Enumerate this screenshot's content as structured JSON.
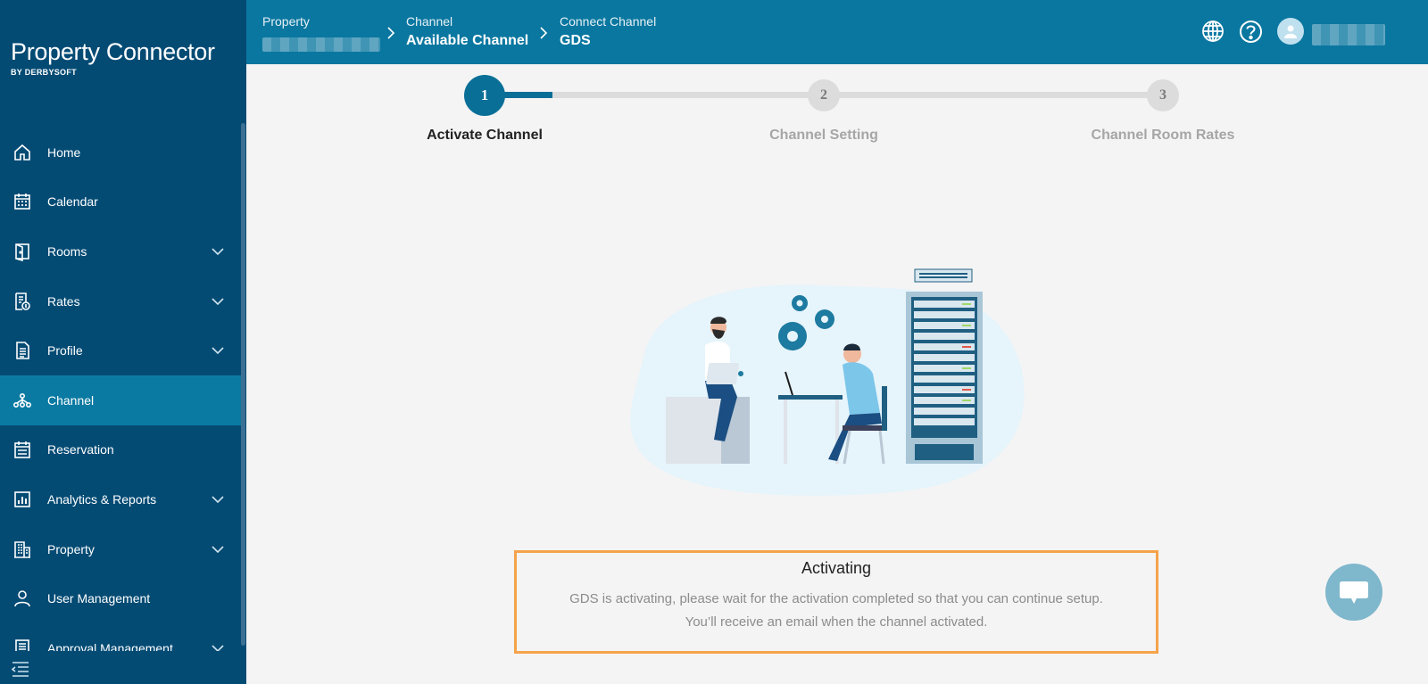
{
  "brand": {
    "name": "Property Connector",
    "sub": "BY DERBYSOFT"
  },
  "sidebar": {
    "items": [
      {
        "label": "Home",
        "icon": "home-icon",
        "expandable": false,
        "active": false
      },
      {
        "label": "Calendar",
        "icon": "calendar-icon",
        "expandable": false,
        "active": false
      },
      {
        "label": "Rooms",
        "icon": "door-icon",
        "expandable": true,
        "active": false
      },
      {
        "label": "Rates",
        "icon": "rates-icon",
        "expandable": true,
        "active": false
      },
      {
        "label": "Profile",
        "icon": "profile-doc-icon",
        "expandable": true,
        "active": false
      },
      {
        "label": "Channel",
        "icon": "channel-icon",
        "expandable": false,
        "active": true
      },
      {
        "label": "Reservation",
        "icon": "reservation-icon",
        "expandable": false,
        "active": false
      },
      {
        "label": "Analytics & Reports",
        "icon": "analytics-icon",
        "expandable": true,
        "active": false
      },
      {
        "label": "Property",
        "icon": "building-icon",
        "expandable": true,
        "active": false
      },
      {
        "label": "User Management",
        "icon": "user-icon",
        "expandable": false,
        "active": false
      },
      {
        "label": "Approval Management",
        "icon": "approval-icon",
        "expandable": true,
        "active": false
      }
    ]
  },
  "header": {
    "breadcrumbs": [
      {
        "label": "Property",
        "value": ""
      },
      {
        "label": "Channel",
        "value": "Available Channel"
      },
      {
        "label": "Connect Channel",
        "value": "GDS"
      }
    ],
    "icons": [
      "globe-icon",
      "help-icon",
      "avatar-icon"
    ]
  },
  "stepper": {
    "steps": [
      {
        "number": "1",
        "label": "Activate Channel",
        "active": true
      },
      {
        "number": "2",
        "label": "Channel Setting",
        "active": false
      },
      {
        "number": "3",
        "label": "Channel Room Rates",
        "active": false
      }
    ],
    "progress": 0.25
  },
  "status": {
    "title": "Activating",
    "message_line1": "GDS is activating, please wait for the activation completed so that you can continue setup.",
    "message_line2": "You’ll receive an email when the channel activated."
  },
  "colors": {
    "sidebar_bg": "#044b74",
    "header_bg": "#0a77a0",
    "active_item": "#0b7aa2",
    "step_active": "#0a6f97",
    "status_border": "#f5a34a"
  }
}
